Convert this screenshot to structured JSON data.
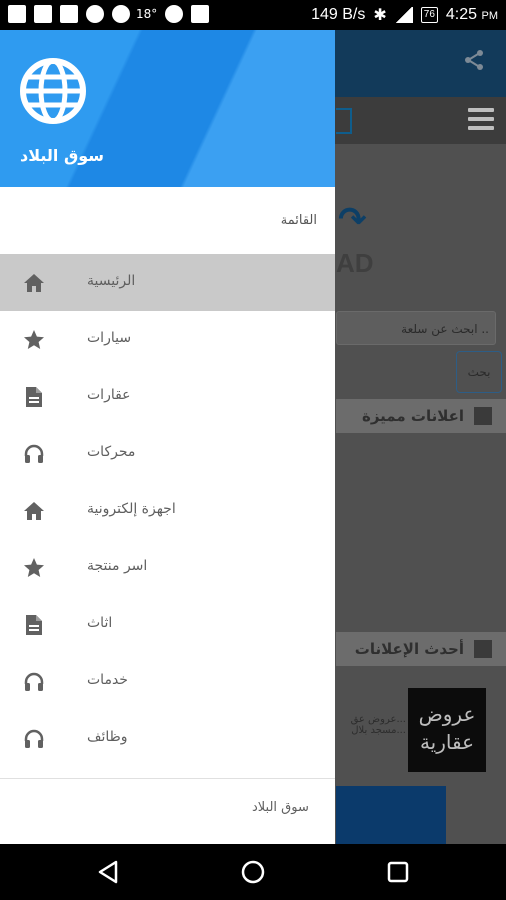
{
  "status_bar": {
    "temperature": "18°",
    "network_speed": "149 B/s",
    "battery": "76",
    "time": "4:25",
    "time_suffix": "PM"
  },
  "background_app": {
    "ad_text": "AD",
    "search_placeholder": "ابحث عن سلعة ..",
    "search_button": "بحث",
    "featured_heading": "اعلانات مميزة",
    "latest_heading": "أحدث الإعلانات",
    "thumbnail_text": "عروض عقارية",
    "listing_title": "عروض عق...",
    "listing_subtitle": "مسجد بلال..."
  },
  "drawer": {
    "header_title": "سوق البلاد",
    "menu_caption": "القائمة",
    "items": [
      {
        "label": "الرئيسية",
        "icon": "home-icon"
      },
      {
        "label": "سيارات",
        "icon": "star-icon"
      },
      {
        "label": "عقارات",
        "icon": "document-icon"
      },
      {
        "label": "محركات",
        "icon": "headphones-icon"
      },
      {
        "label": "اجهزة إلكترونية",
        "icon": "home-icon"
      },
      {
        "label": "اسر منتجة",
        "icon": "star-icon"
      },
      {
        "label": "اثاث",
        "icon": "document-icon"
      },
      {
        "label": "خدمات",
        "icon": "headphones-icon"
      },
      {
        "label": "وظائف",
        "icon": "headphones-icon"
      }
    ],
    "footer_label": "سوق البلاد"
  },
  "colors": {
    "header_blue": "#1e88e5",
    "active_item": "#c9c9c9",
    "icon_gray": "#616161"
  }
}
